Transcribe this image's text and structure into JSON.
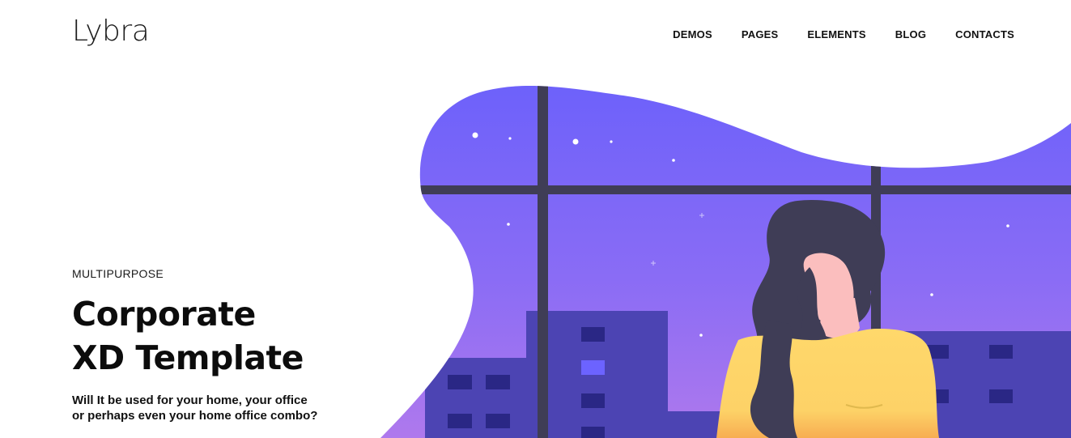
{
  "brand": {
    "name": "Lybra"
  },
  "nav": {
    "items": [
      "DEMOS",
      "PAGES",
      "ELEMENTS",
      "BLOG",
      "CONTACTS"
    ]
  },
  "hero": {
    "eyebrow": "MULTIPURPOSE",
    "title_line1": "Corporate",
    "title_line2": "XD Template",
    "subtitle_line1": "Will It be used for your home, your office",
    "subtitle_line2": "or perhaps even your home office combo?"
  },
  "colors": {
    "sky_top": "#6a60fb",
    "sky_bottom": "#b179ec",
    "window_frame": "#3f3d56",
    "building": "#4c44b3",
    "hair": "#3f3d56",
    "skin": "#fbbebe",
    "sweater": "#ffd86b"
  }
}
